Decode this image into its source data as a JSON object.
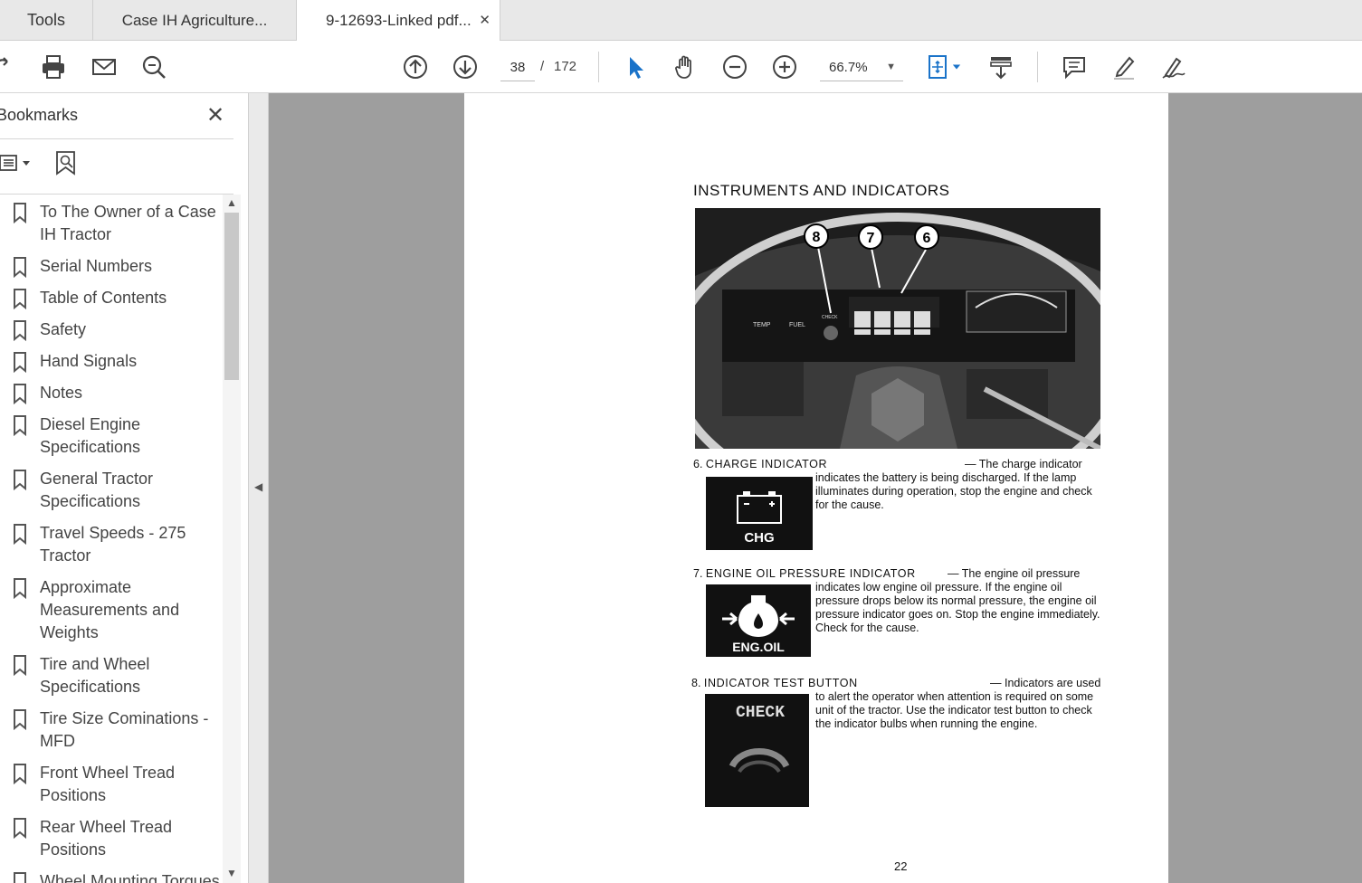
{
  "tabs": {
    "tools": "Tools",
    "doc1": "Case IH Agriculture...",
    "doc2": "9-12693-Linked pdf..."
  },
  "toolbar": {
    "page_current": "38",
    "page_sep": "/",
    "page_total": "172",
    "zoom": "66.7%"
  },
  "sidebar": {
    "title": "Bookmarks",
    "items": [
      {
        "label": "To The Owner of a Case IH Tractor"
      },
      {
        "label": "Serial Numbers"
      },
      {
        "label": "Table of Contents"
      },
      {
        "label": "Safety"
      },
      {
        "label": "Hand Signals"
      },
      {
        "label": "Notes"
      },
      {
        "label": "Diesel Engine Specifications"
      },
      {
        "label": "General Tractor Specifications"
      },
      {
        "label": "Travel Speeds - 275 Tractor"
      },
      {
        "label": "Approximate Measurements and Weights"
      },
      {
        "label": "Tire and Wheel Specifications"
      },
      {
        "label": "Tire Size Cominations - MFD"
      },
      {
        "label": "Front Wheel Tread Positions"
      },
      {
        "label": "Rear Wheel Tread Positions"
      },
      {
        "label": "Wheel Mounting Torques"
      }
    ]
  },
  "document": {
    "heading": "INSTRUMENTS AND INDICATORS",
    "photo": {
      "callouts": [
        "8",
        "7",
        "6"
      ],
      "gauge_labels": [
        "TEMP",
        "FUEL",
        "CHECK"
      ]
    },
    "sections": [
      {
        "number": "6.",
        "title": "CHARGE INDICATOR",
        "text": "— The charge indicator indicates the battery is being discharged. If the lamp illuminates during operation, stop the engine and check for the cause.",
        "icon_label": "CHG"
      },
      {
        "number": "7.",
        "title": "ENGINE OIL PRESSURE INDICATOR",
        "text": "— The engine oil pressure indicates low engine oil pressure. If the engine oil pressure drops below its normal pressure, the engine oil pressure indicator goes on. Stop the engine immediately. Check for the cause.",
        "icon_label": "ENG.OIL"
      },
      {
        "number": "8.",
        "title": "INDICATOR TEST BUTTON",
        "text": "— Indicators are used to alert the operator when attention is required on some unit of the tractor. Use the indicator test button to check the indicator bulbs when running the engine.",
        "icon_label": "CHECK"
      }
    ],
    "page_number": "22"
  }
}
